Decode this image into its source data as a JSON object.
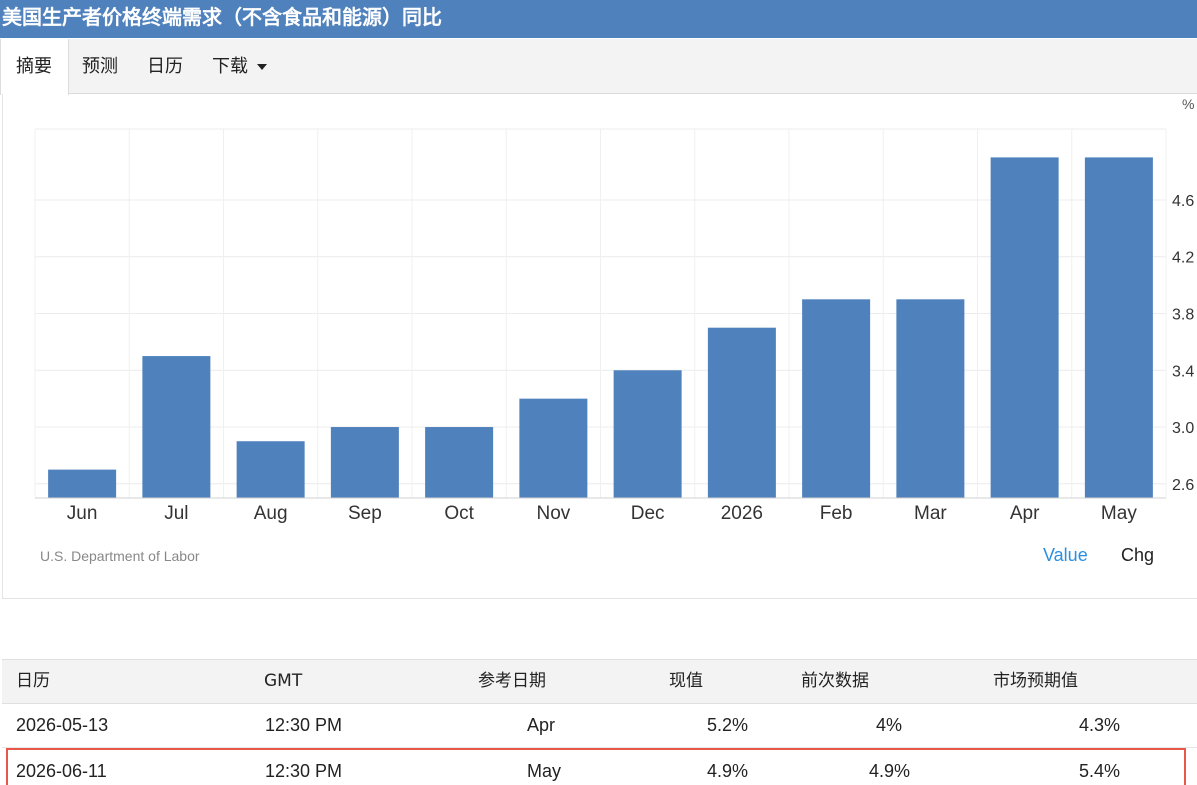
{
  "title": "美国生产者价格终端需求（不含食品和能源）同比",
  "tabs": [
    {
      "label": "摘要"
    },
    {
      "label": "预测"
    },
    {
      "label": "日历"
    },
    {
      "label": "下载"
    }
  ],
  "chart": {
    "source": "U.S. Department of Labor",
    "toggle_value": "Value",
    "toggle_chg": "Chg"
  },
  "chart_data": {
    "type": "bar",
    "categories": [
      "Jun",
      "Jul",
      "Aug",
      "Sep",
      "Oct",
      "Nov",
      "Dec",
      "2026",
      "Feb",
      "Mar",
      "Apr",
      "May"
    ],
    "values": [
      2.7,
      3.5,
      2.9,
      3.0,
      3.0,
      3.2,
      3.4,
      3.7,
      3.9,
      3.9,
      4.9,
      4.9
    ],
    "ylim": [
      2.5,
      5.1
    ],
    "yticks": [
      "2.6",
      "3.0",
      "3.4",
      "3.8",
      "4.2",
      "4.6"
    ],
    "yunit": "%",
    "y_axis_side": "right",
    "bar_color": "#4f81bd",
    "grid": true
  },
  "table": {
    "headers": [
      "日历",
      "GMT",
      "参考日期",
      "现值",
      "前次数据",
      "市场预期值"
    ],
    "rows": [
      {
        "date": "2026-05-13",
        "time": "12:30 PM",
        "ref": "Apr",
        "actual": "5.2%",
        "previous": "4%",
        "consensus": "4.3%"
      },
      {
        "date": "2026-06-11",
        "time": "12:30 PM",
        "ref": "May",
        "actual": "4.9%",
        "previous": "4.9%",
        "consensus": "5.4%"
      }
    ],
    "highlight_color": "#e8584a"
  }
}
